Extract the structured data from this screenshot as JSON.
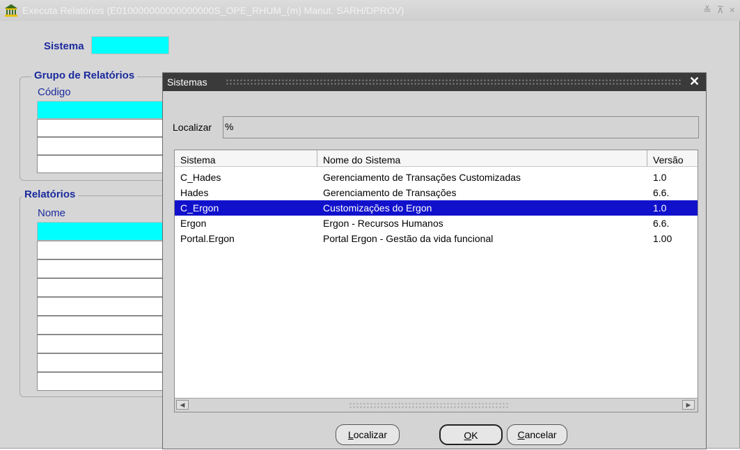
{
  "window": {
    "title": "Executa Relatórios (E010000000000000000S_OPE_RHUM_(m) Manut. SARH/DPROV)",
    "controls": "≚ ⊼ ×"
  },
  "form": {
    "sistema_label": "Sistema",
    "grupo_title": "Grupo de Relatórios",
    "codigo_label": "Código",
    "relatorios_title": "Relatórios",
    "nome_label": "Nome"
  },
  "dialog": {
    "title": "Sistemas",
    "close": "✕",
    "find_label": "Localizar",
    "find_value": "%",
    "columns": [
      "Sistema",
      "Nome do Sistema",
      "Versão"
    ],
    "rows": [
      {
        "sistema": "C_Hades",
        "nome": "Gerenciamento de Transações Customizadas",
        "versao": "1.0"
      },
      {
        "sistema": "Hades",
        "nome": "Gerenciamento de Transações",
        "versao": "6.6."
      },
      {
        "sistema": "C_Ergon",
        "nome": "Customizações do Ergon",
        "versao": "1.0"
      },
      {
        "sistema": "Ergon",
        "nome": "Ergon - Recursos Humanos",
        "versao": "6.6."
      },
      {
        "sistema": "Portal.Ergon",
        "nome": "Portal Ergon - Gestão da vida funcional",
        "versao": "1.00"
      }
    ],
    "selected_row": 2,
    "buttons": {
      "find_prefix": "L",
      "find_rest": "ocalizar",
      "ok_prefix": "O",
      "ok_rest": "K",
      "cancel_prefix": "C",
      "cancel_rest": "ancelar"
    }
  },
  "colors": {
    "selection": "#1111cc",
    "required_field": "#00ffff",
    "label_blue": "#1a2a9c"
  }
}
